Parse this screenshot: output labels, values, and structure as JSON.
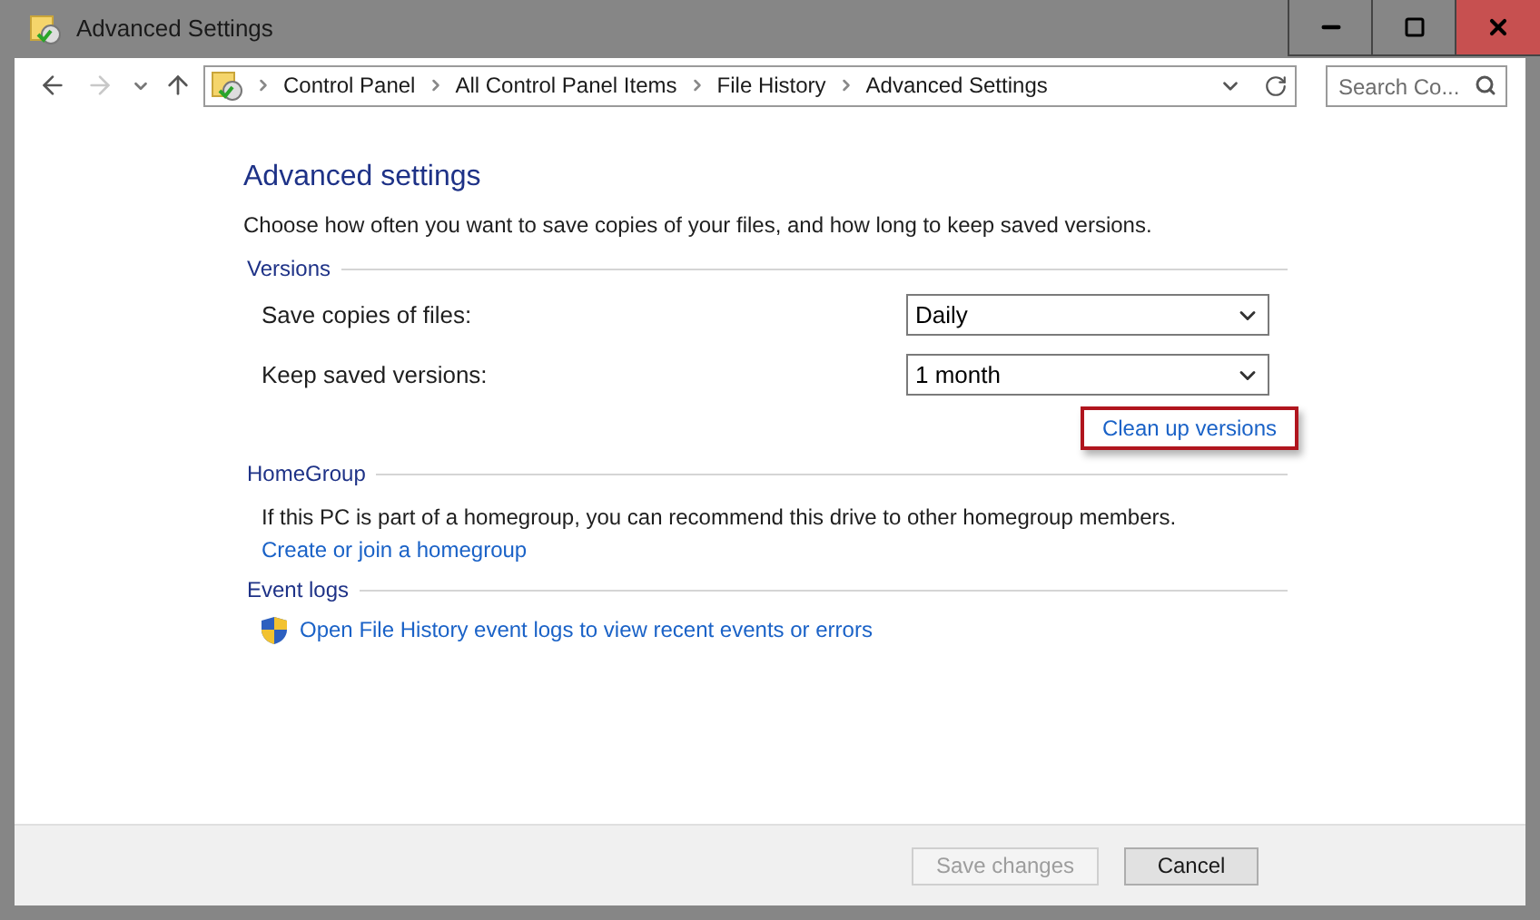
{
  "window": {
    "title": "Advanced Settings"
  },
  "nav": {
    "back_disabled": false,
    "forward_disabled": true
  },
  "breadcrumbs": [
    "Control Panel",
    "All Control Panel Items",
    "File History",
    "Advanced Settings"
  ],
  "search": {
    "placeholder": "Search Co..."
  },
  "heading": "Advanced settings",
  "intro": "Choose how often you want to save copies of your files, and how long to keep saved versions.",
  "sections": [
    {
      "title": "Versions",
      "items": [
        {
          "kind": "dropdown",
          "label": "Save copies of files:",
          "value": "Daily"
        },
        {
          "kind": "dropdown",
          "label": "Keep saved versions:",
          "value": "1 month"
        },
        {
          "kind": "link",
          "text": "Clean up versions",
          "highlighted": true
        }
      ]
    },
    {
      "title": "HomeGroup",
      "items": [
        {
          "kind": "text",
          "text": "If this PC is part of a homegroup, you can recommend this drive to other homegroup members."
        },
        {
          "kind": "textlink",
          "text": "Create or join a homegroup"
        }
      ]
    },
    {
      "title": "Event logs",
      "items": [
        {
          "kind": "shieldlink",
          "text": "Open File History event logs to view recent events or errors"
        }
      ]
    }
  ],
  "buttons": [
    {
      "label": "Save changes",
      "disabled": true
    },
    {
      "label": "Cancel",
      "disabled": false
    }
  ]
}
